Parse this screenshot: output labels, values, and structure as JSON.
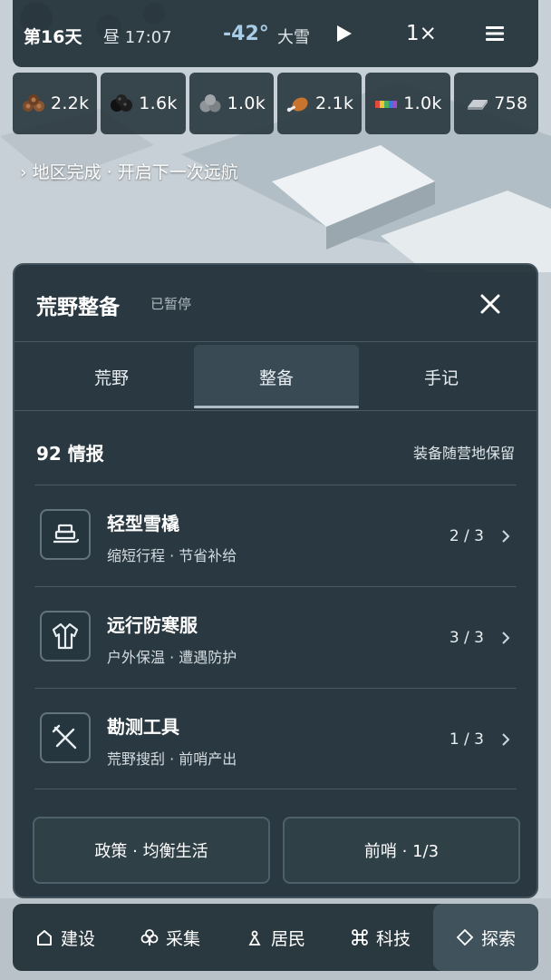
{
  "status": {
    "day": "第16天",
    "time": "昼 17:07",
    "temperature": "-42°",
    "weather": "大雪",
    "speed": "1×"
  },
  "resources": [
    {
      "icon": "wood-icon",
      "value": "2.2k"
    },
    {
      "icon": "coal-icon",
      "value": "1.6k"
    },
    {
      "icon": "stone-icon",
      "value": "1.0k"
    },
    {
      "icon": "meat-icon",
      "value": "2.1k"
    },
    {
      "icon": "textile-icon",
      "value": "1.0k"
    },
    {
      "icon": "steel-icon",
      "value": "758"
    }
  ],
  "notice": "› 地区完成 · 开启下一次远航",
  "panel": {
    "title": "荒野整备",
    "status": "已暂停",
    "tabs": [
      {
        "label": "荒野",
        "active": false
      },
      {
        "label": "整备",
        "active": true
      },
      {
        "label": "手记",
        "active": false
      }
    ],
    "intel": "92 情报",
    "keep_note": "装备随营地保留",
    "items": [
      {
        "icon": "sled-icon",
        "name": "轻型雪橇",
        "desc": "缩短行程 · 节省补给",
        "count": "2 / 3"
      },
      {
        "icon": "coat-icon",
        "name": "远行防寒服",
        "desc": "户外保温 · 遭遇防护",
        "count": "3 / 3"
      },
      {
        "icon": "tools-icon",
        "name": "勘测工具",
        "desc": "荒野搜刮 · 前哨产出",
        "count": "1 / 3"
      }
    ],
    "policy_button": "政策 · 均衡生活",
    "outpost_button": "前哨 · 1/3"
  },
  "nav": [
    {
      "icon": "build-icon",
      "label": "建设",
      "active": false
    },
    {
      "icon": "gather-icon",
      "label": "采集",
      "active": false
    },
    {
      "icon": "residents-icon",
      "label": "居民",
      "active": false
    },
    {
      "icon": "tech-icon",
      "label": "科技",
      "active": false
    },
    {
      "icon": "explore-icon",
      "label": "探索",
      "active": true
    }
  ]
}
